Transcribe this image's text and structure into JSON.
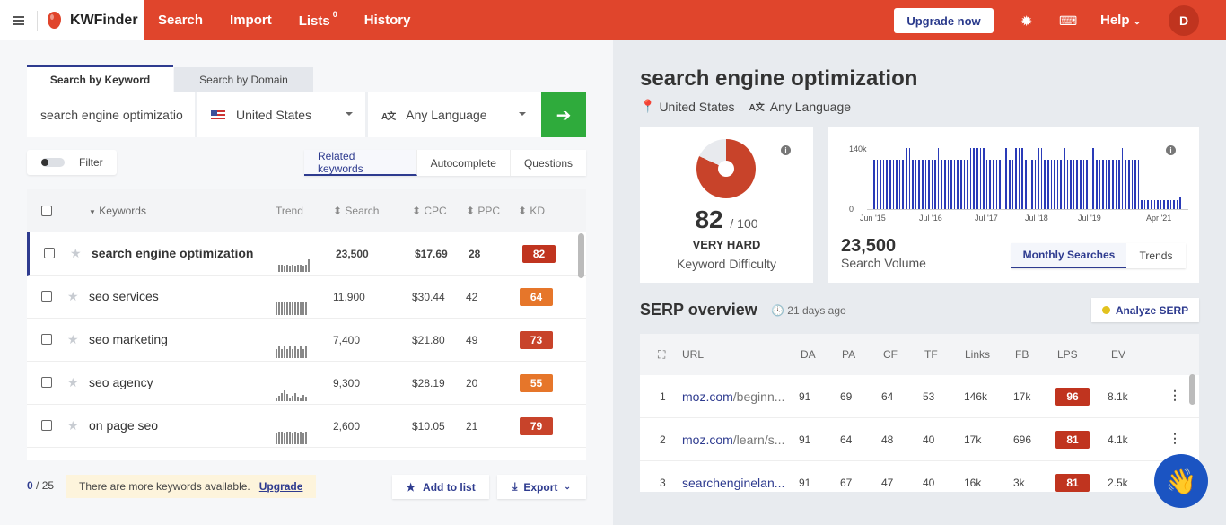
{
  "brand": "KWFinder",
  "nav": [
    {
      "label": "Search"
    },
    {
      "label": "Import"
    },
    {
      "label": "Lists",
      "badge": "0"
    },
    {
      "label": "History"
    }
  ],
  "header": {
    "upgrade": "Upgrade now",
    "help": "Help",
    "avatar": "D"
  },
  "search": {
    "tab_keyword": "Search by Keyword",
    "tab_domain": "Search by Domain",
    "keyword_value": "search engine optimizatio",
    "location": "United States",
    "language": "Any Language"
  },
  "filter_label": "Filter",
  "modes": [
    "Related keywords",
    "Autocomplete",
    "Questions"
  ],
  "keywords_table": {
    "headers": {
      "keywords": "Keywords",
      "trend": "Trend",
      "search": "Search",
      "cpc": "CPC",
      "ppc": "PPC",
      "kd": "KD"
    },
    "rows": [
      {
        "keyword": "search engine optimization",
        "search": "23,500",
        "cpc": "$17.69",
        "ppc": "28",
        "kd": "82",
        "kd_color": "#c0341f",
        "trend": [
          8,
          8,
          7,
          8,
          7,
          8,
          7,
          8,
          8,
          7,
          8,
          14
        ]
      },
      {
        "keyword": "seo services",
        "search": "11,900",
        "cpc": "$30.44",
        "ppc": "42",
        "kd": "64",
        "kd_color": "#e6762a",
        "trend": [
          14,
          14,
          14,
          14,
          14,
          14,
          14,
          14,
          14,
          14,
          14,
          14
        ]
      },
      {
        "keyword": "seo marketing",
        "search": "7,400",
        "cpc": "$21.80",
        "ppc": "49",
        "kd": "73",
        "kd_color": "#c8432a",
        "trend": [
          10,
          13,
          10,
          13,
          10,
          13,
          10,
          13,
          10,
          13,
          10,
          13
        ]
      },
      {
        "keyword": "seo agency",
        "search": "9,300",
        "cpc": "$28.19",
        "ppc": "20",
        "kd": "55",
        "kd_color": "#e6762a",
        "trend": [
          4,
          6,
          9,
          12,
          8,
          4,
          6,
          9,
          5,
          4,
          7,
          5
        ]
      },
      {
        "keyword": "on page seo",
        "search": "2,600",
        "cpc": "$10.05",
        "ppc": "21",
        "kd": "79",
        "kd_color": "#c8432a",
        "trend": [
          12,
          14,
          14,
          13,
          14,
          14,
          13,
          14,
          12,
          14,
          13,
          14
        ]
      }
    ]
  },
  "footer": {
    "count_current": "0",
    "count_total": "/ 25",
    "more_text": "There are more keywords available.",
    "more_link": "Upgrade",
    "add_to_list": "Add to list",
    "export": "Export"
  },
  "detail": {
    "keyword": "search engine optimization",
    "location": "United States",
    "language": "Any Language",
    "kd_value": "82",
    "kd_max": "/ 100",
    "kd_label": "VERY HARD",
    "kd_caption": "Keyword Difficulty",
    "search_volume": "23,500",
    "search_volume_caption": "Search Volume",
    "sv_tabs": [
      "Monthly Searches",
      "Trends"
    ]
  },
  "chart_data": {
    "type": "bar",
    "title": "",
    "ylabel": "",
    "xlabel": "",
    "y_ticks": [
      "140k",
      "0"
    ],
    "x_ticks": [
      "Jun '15",
      "Jul '16",
      "Jul '17",
      "Jul '18",
      "Jul '19",
      "Apr '21"
    ],
    "ylim": [
      0,
      150000
    ],
    "series_color": "#2a3bb8",
    "values": [
      110000,
      110000,
      110000,
      110000,
      110000,
      110000,
      110000,
      110000,
      110000,
      110000,
      135000,
      135000,
      110000,
      110000,
      110000,
      110000,
      110000,
      110000,
      110000,
      110000,
      135000,
      110000,
      110000,
      110000,
      110000,
      110000,
      110000,
      110000,
      110000,
      110000,
      135000,
      135000,
      135000,
      135000,
      135000,
      110000,
      110000,
      110000,
      110000,
      110000,
      110000,
      135000,
      110000,
      110000,
      135000,
      135000,
      135000,
      110000,
      110000,
      110000,
      110000,
      135000,
      135000,
      110000,
      110000,
      110000,
      110000,
      110000,
      110000,
      135000,
      110000,
      110000,
      110000,
      110000,
      110000,
      110000,
      110000,
      110000,
      135000,
      110000,
      110000,
      110000,
      110000,
      110000,
      110000,
      110000,
      110000,
      135000,
      110000,
      110000,
      110000,
      110000,
      110000,
      20000,
      20000,
      20000,
      20000,
      20000,
      20000,
      20000,
      20000,
      20000,
      20000,
      20000,
      20000,
      25000
    ]
  },
  "serp": {
    "title": "SERP overview",
    "ago": "21 days ago",
    "analyze": "Analyze SERP",
    "headers": [
      "URL",
      "DA",
      "PA",
      "CF",
      "TF",
      "Links",
      "FB",
      "LPS",
      "EV"
    ],
    "rows": [
      {
        "rank": "1",
        "domain": "moz.com",
        "path": "/beginn...",
        "da": "91",
        "pa": "69",
        "cf": "64",
        "tf": "53",
        "links": "146k",
        "fb": "17k",
        "lps": "96",
        "ev": "8.1k"
      },
      {
        "rank": "2",
        "domain": "moz.com",
        "path": "/learn/s...",
        "da": "91",
        "pa": "64",
        "cf": "48",
        "tf": "40",
        "links": "17k",
        "fb": "696",
        "lps": "81",
        "ev": "4.1k"
      },
      {
        "rank": "3",
        "domain": "searchenginelan...",
        "path": "",
        "da": "91",
        "pa": "67",
        "cf": "47",
        "tf": "40",
        "links": "16k",
        "fb": "3k",
        "lps": "81",
        "ev": "2.5k"
      }
    ]
  }
}
